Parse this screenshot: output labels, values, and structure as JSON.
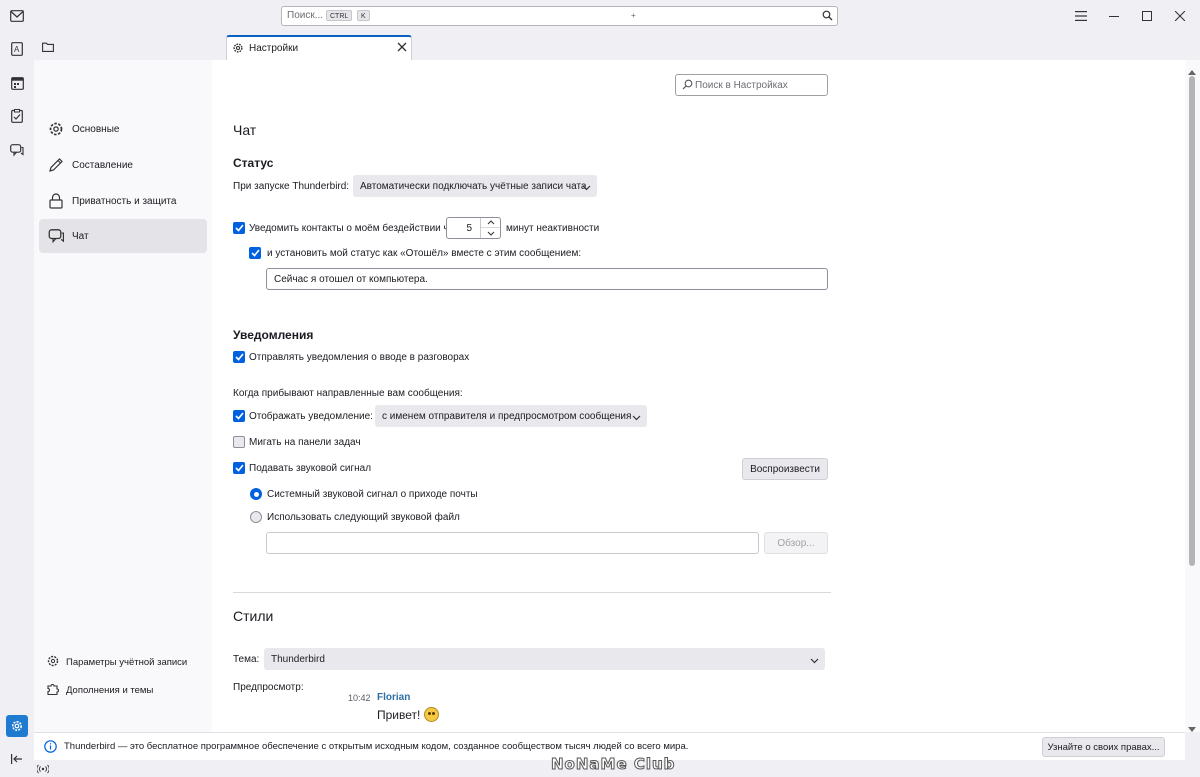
{
  "titlebar": {
    "search_placeholder": "Поиск...",
    "shortcut_key1": "CTRL",
    "shortcut_plus": "+",
    "shortcut_key2": "K"
  },
  "tabs": [
    {
      "label": "Настройки"
    }
  ],
  "sidebar": {
    "categories": [
      {
        "label": "Основные",
        "icon": "gear-icon"
      },
      {
        "label": "Составление",
        "icon": "pencil-icon"
      },
      {
        "label": "Приватность и защита",
        "icon": "lock-icon"
      },
      {
        "label": "Чат",
        "icon": "chat-icon",
        "active": true
      }
    ],
    "footer": [
      {
        "label": "Параметры учётной записи",
        "icon": "account-settings-icon"
      },
      {
        "label": "Дополнения и темы",
        "icon": "puzzle-icon"
      }
    ]
  },
  "find_placeholder": "Поиск в Настройках",
  "chat": {
    "heading": "Чат",
    "status": {
      "heading": "Статус",
      "startup_label": "При запуске Thunderbird:",
      "startup_value": "Автоматически подключать учётные записи чата",
      "idle_label": "Уведомить контакты о моём бездействии через",
      "idle_minutes": "5",
      "idle_suffix": "минут неактивности",
      "idle_checked": true,
      "away_label": "и установить мой статус как «Отошёл» вместе с этим сообщением:",
      "away_checked": true,
      "away_message": "Сейчас я отошел от компьютера."
    },
    "notifications": {
      "heading": "Уведомления",
      "typing_label": "Отправлять уведомления о вводе в разговорах",
      "typing_checked": true,
      "incoming_label": "Когда прибывают направленные вам сообщения:",
      "show_label": "Отображать уведомление:",
      "show_checked": true,
      "show_value": "с именем отправителя и предпросмотром сообщения",
      "flash_label": "Мигать на панели задач",
      "flash_checked": false,
      "sound_label": "Подавать звуковой сигнал",
      "sound_checked": true,
      "play_button": "Воспроизвести",
      "system_sound_label": "Системный звуковой сигнал о приходе почты",
      "custom_sound_label": "Использовать следующий звуковой файл",
      "browse_button": "Обзор..."
    },
    "styles": {
      "heading": "Стили",
      "theme_label": "Тема:",
      "theme_value": "Thunderbird",
      "preview_label": "Предпросмотр:",
      "preview_time": "10:42",
      "preview_sender": "Florian",
      "preview_message": "Привет!"
    }
  },
  "notice": {
    "text": "Thunderbird — это бесплатное программное обеспечение с открытым исходным кодом, созданное сообществом тысяч людей со всего мира.",
    "button": "Узнайте о своих правах..."
  },
  "watermark": "NoNaMe Club",
  "colors": {
    "accent": "#0061e0",
    "tab_accent": "#0b60c1",
    "sender": "#2e6ea6"
  }
}
